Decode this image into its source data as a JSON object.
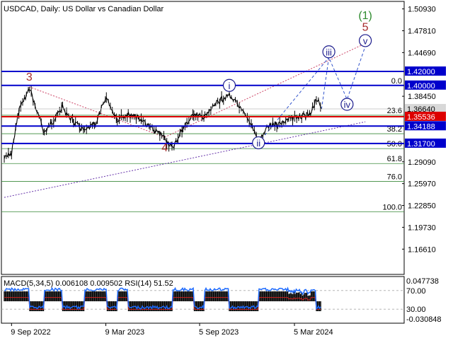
{
  "chart_data": {
    "type": "candlestick-line",
    "title": "USDCAD, Daily:  US Dollar vs Canadian Dollar",
    "price_axis": {
      "ylim": [
        1.13,
        1.52
      ],
      "ticks": [
        "1.50930",
        "1.47810",
        "1.44690",
        "1.38450",
        "1.29090",
        "1.25970",
        "1.22850",
        "1.19730",
        "1.16610"
      ]
    },
    "x_axis": {
      "tick_labels": [
        "9 Sep 2022",
        "9 Mar 2023",
        "5 Sep 2023",
        "5 Mar 2024"
      ]
    },
    "horizontal_levels": [
      {
        "price": 1.42,
        "label": "1.42000",
        "color": "#0000cc",
        "type": "boxed"
      },
      {
        "price": 1.4,
        "label": "1.40000",
        "color": "#0000cc",
        "type": "boxed"
      },
      {
        "price": 1.3664,
        "label": "1.36640",
        "color": "#c0c0c0",
        "type": "current"
      },
      {
        "price": 1.35536,
        "label": "1.35536",
        "color": "#dd0000",
        "type": "boxed"
      },
      {
        "price": 1.34188,
        "label": "1.34188",
        "color": "#0000cc",
        "type": "boxed"
      },
      {
        "price": 1.317,
        "label": "1.31700",
        "color": "#0000cc",
        "type": "boxed"
      }
    ],
    "fibonacci_levels": [
      {
        "label": "0.0",
        "price": 1.4
      },
      {
        "label": "23.6",
        "price": 1.3574
      },
      {
        "label": "38.2",
        "price": 1.331
      },
      {
        "label": "50.0",
        "price": 1.3097
      },
      {
        "label": "61.8",
        "price": 1.2884
      },
      {
        "label": "76.0",
        "price": 1.2628
      },
      {
        "label": "100.0",
        "price": 1.2194
      }
    ],
    "wave_labels": [
      {
        "text": "(1)",
        "color": "#2e8b2e"
      },
      {
        "text": "5",
        "color": "#a52a2a"
      },
      {
        "text": "3",
        "color": "#a52a2a"
      },
      {
        "text": "4",
        "color": "#a52a2a"
      },
      {
        "text": "i",
        "color": "#1a1a8c",
        "circled": true
      },
      {
        "text": "ii",
        "color": "#1a1a8c",
        "circled": true
      },
      {
        "text": "iii",
        "color": "#1a1a8c",
        "circled": true
      },
      {
        "text": "iv",
        "color": "#1a1a8c",
        "circled": true
      },
      {
        "text": "v",
        "color": "#1a1a8c",
        "circled": true
      }
    ],
    "price_series": [
      {
        "date": "2022-08-26",
        "close": 1.295
      },
      {
        "date": "2022-09-09",
        "close": 1.303
      },
      {
        "date": "2022-09-23",
        "close": 1.364
      },
      {
        "date": "2022-10-13",
        "close": 1.396
      },
      {
        "date": "2022-10-28",
        "close": 1.363
      },
      {
        "date": "2022-11-11",
        "close": 1.333
      },
      {
        "date": "2022-11-25",
        "close": 1.347
      },
      {
        "date": "2022-12-16",
        "close": 1.368
      },
      {
        "date": "2023-01-06",
        "close": 1.348
      },
      {
        "date": "2023-01-27",
        "close": 1.333
      },
      {
        "date": "2023-02-17",
        "close": 1.346
      },
      {
        "date": "2023-03-10",
        "close": 1.383
      },
      {
        "date": "2023-03-31",
        "close": 1.352
      },
      {
        "date": "2023-04-21",
        "close": 1.358
      },
      {
        "date": "2023-05-12",
        "close": 1.353
      },
      {
        "date": "2023-06-02",
        "close": 1.34
      },
      {
        "date": "2023-06-30",
        "close": 1.325
      },
      {
        "date": "2023-07-14",
        "close": 1.31
      },
      {
        "date": "2023-08-04",
        "close": 1.338
      },
      {
        "date": "2023-08-25",
        "close": 1.359
      },
      {
        "date": "2023-09-15",
        "close": 1.354
      },
      {
        "date": "2023-10-06",
        "close": 1.374
      },
      {
        "date": "2023-11-01",
        "close": 1.388
      },
      {
        "date": "2023-11-24",
        "close": 1.364
      },
      {
        "date": "2023-12-15",
        "close": 1.342
      },
      {
        "date": "2023-12-27",
        "close": 1.318
      },
      {
        "date": "2024-01-12",
        "close": 1.34
      },
      {
        "date": "2024-02-02",
        "close": 1.345
      },
      {
        "date": "2024-02-23",
        "close": 1.352
      },
      {
        "date": "2024-03-15",
        "close": 1.355
      },
      {
        "date": "2024-04-05",
        "close": 1.358
      },
      {
        "date": "2024-04-16",
        "close": 1.382
      },
      {
        "date": "2024-04-26",
        "close": 1.366
      }
    ],
    "projection": {
      "points": [
        {
          "date": "2024-04-26",
          "price": 1.366
        },
        {
          "date": "2024-05-10",
          "price": 1.44
        },
        {
          "date": "2024-06-14",
          "price": 1.38
        },
        {
          "date": "2024-07-19",
          "price": 1.456
        }
      ]
    },
    "indicator_panel": {
      "label": "MACD(5,34,5) 0.006108 0.009502 RSI(14) 51.52",
      "left_scale": [
        "70.00",
        "30.00"
      ],
      "right_scale": [
        "0.047738",
        "-0.030848"
      ],
      "rsi_levels": [
        70,
        30
      ],
      "rsi_ylim": [
        0,
        100
      ]
    },
    "colors": {
      "candle": "#000000",
      "blue_level": "#0000cc",
      "red_level": "#dd0000",
      "fib_line": "#3a8a3a",
      "trend_purple": "#6633aa",
      "trend_red": "#cc4466",
      "projection": "#3355cc",
      "macd_hist": "#000000",
      "macd_signal": "#cc2222",
      "rsi_line": "#1e6bff"
    }
  }
}
